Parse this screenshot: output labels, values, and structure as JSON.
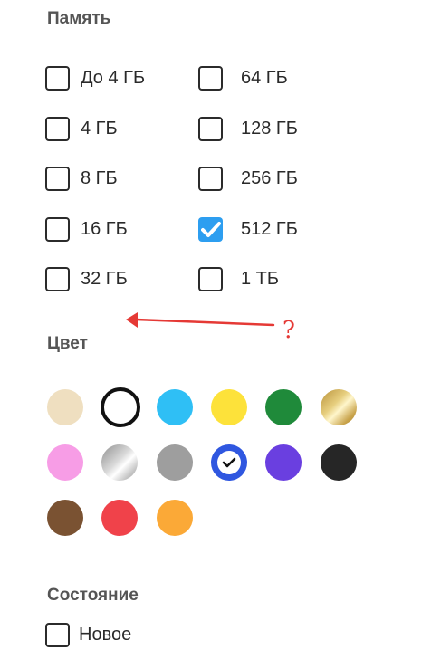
{
  "memory": {
    "title": "Память",
    "options": [
      {
        "label": "До 4 ГБ",
        "checked": false
      },
      {
        "label": "4 ГБ",
        "checked": false
      },
      {
        "label": "8 ГБ",
        "checked": false
      },
      {
        "label": "16 ГБ",
        "checked": false
      },
      {
        "label": "32 ГБ",
        "checked": false
      },
      {
        "label": "64 ГБ",
        "checked": false
      },
      {
        "label": "128 ГБ",
        "checked": false
      },
      {
        "label": "256 ГБ",
        "checked": false
      },
      {
        "label": "512 ГБ",
        "checked": true
      },
      {
        "label": "1 ТБ",
        "checked": false
      }
    ]
  },
  "color": {
    "title": "Цвет",
    "swatches": [
      {
        "name": "beige",
        "hex": "#efdfc0"
      },
      {
        "name": "white",
        "hex": "#ffffff",
        "selected": true
      },
      {
        "name": "light-blue",
        "hex": "#2fbff5"
      },
      {
        "name": "yellow",
        "hex": "#fde23a"
      },
      {
        "name": "green",
        "hex": "#1f8a3a"
      },
      {
        "name": "gold",
        "hex": "#c9a84f"
      },
      {
        "name": "pink",
        "hex": "#f79de6"
      },
      {
        "name": "silver",
        "hex": "#bdbdbd"
      },
      {
        "name": "gray",
        "hex": "#9e9e9e"
      },
      {
        "name": "blue",
        "hex": "#2f57e0",
        "checked": true
      },
      {
        "name": "purple",
        "hex": "#6a3fe0"
      },
      {
        "name": "black",
        "hex": "#262626"
      },
      {
        "name": "brown",
        "hex": "#7a5232"
      },
      {
        "name": "red",
        "hex": "#f0424a"
      },
      {
        "name": "orange",
        "hex": "#fba937"
      }
    ]
  },
  "condition": {
    "title": "Состояние",
    "options": [
      {
        "label": "Новое",
        "checked": false
      }
    ]
  },
  "annotation": {
    "mark": "?",
    "color": "#e53935"
  }
}
